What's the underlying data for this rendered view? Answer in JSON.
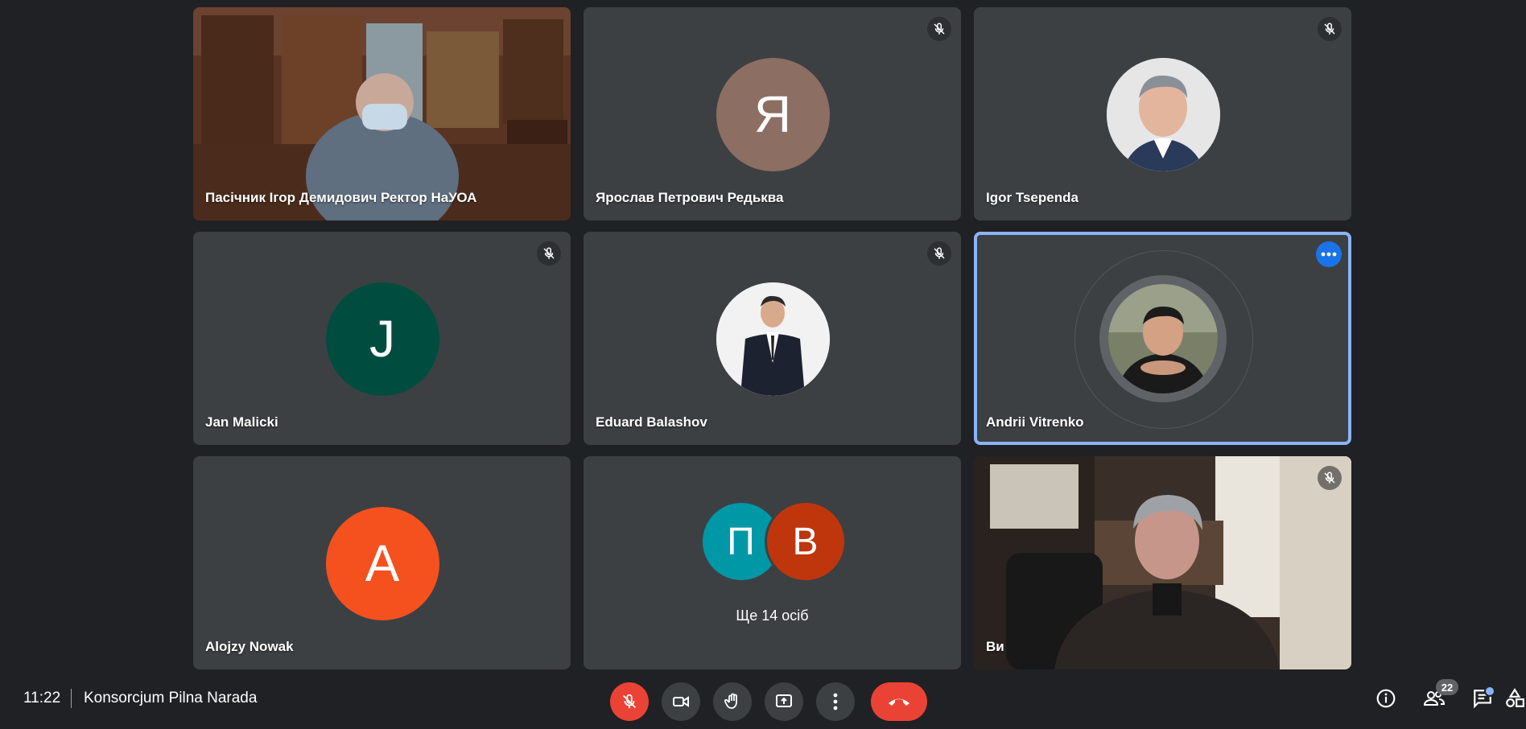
{
  "participants": [
    {
      "name": "Пасічник Ігор Демидович Ректор НаУОА"
    },
    {
      "name": "Ярослав Петрович Редьква",
      "initial": "Я",
      "color": "#8d6e63"
    },
    {
      "name": "Igor Tsependa"
    },
    {
      "name": "Jan Malicki",
      "initial": "J",
      "color": "#004d40"
    },
    {
      "name": "Eduard Balashov"
    },
    {
      "name": "Andrii Vitrenko"
    },
    {
      "name": "Alojzy Nowak",
      "initial": "A",
      "color": "#f4511e"
    },
    {
      "name": "Ви"
    }
  ],
  "others": {
    "initials": [
      "П",
      "В"
    ],
    "colors": [
      "#0097a7",
      "#bf360c"
    ],
    "label": "Ще 14 осіб"
  },
  "bottom_bar": {
    "time": "11:22",
    "meeting_name": "Konsorcjum Pilna Narada",
    "participant_count": "22"
  },
  "icons": {
    "mic": "mic-off-icon",
    "camera": "videocam-icon",
    "hand": "raise-hand-icon",
    "present": "present-screen-icon",
    "more": "more-vert-icon",
    "end": "call-end-icon",
    "info": "info-icon",
    "people": "people-icon",
    "chat": "chat-icon",
    "activities": "activities-icon"
  },
  "colors": {
    "background": "#202124",
    "tile": "#3c4043",
    "active_border": "#8ab4f8",
    "danger": "#ea4335",
    "accent": "#1a73e8"
  }
}
